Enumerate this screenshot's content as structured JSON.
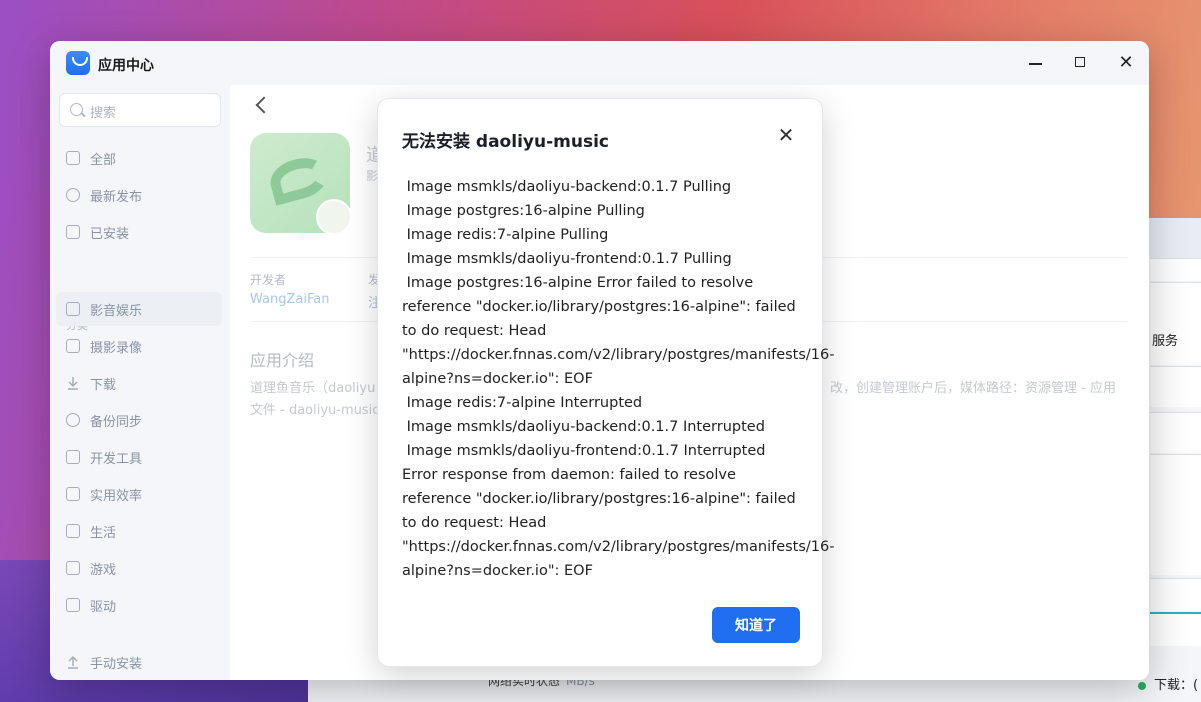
{
  "window": {
    "title": "应用中心"
  },
  "sidebar": {
    "search_placeholder": "搜索",
    "items": [
      {
        "label": "全部"
      },
      {
        "label": "最新发布"
      },
      {
        "label": "已安装"
      }
    ],
    "category_label": "分类",
    "categories": [
      {
        "label": "影音娱乐"
      },
      {
        "label": "摄影录像"
      },
      {
        "label": "下载"
      },
      {
        "label": "备份同步"
      },
      {
        "label": "开发工具"
      },
      {
        "label": "实用效率"
      },
      {
        "label": "生活"
      },
      {
        "label": "游戏"
      },
      {
        "label": "驱动"
      }
    ],
    "manual_install": "手动安装"
  },
  "app_detail": {
    "name_partial": "道",
    "sub_partial": "影",
    "developer_label": "开发者",
    "developer_value": "WangZaiFan",
    "meta2_label": "发",
    "meta2_value": "注",
    "intro_title": "应用介绍",
    "intro_left": "道理鱼音乐（daoliyu",
    "intro_left2": "文件 - daoliyu-music",
    "intro_right": "改，创建管理账户后，媒体路径：资源管理 - 应用"
  },
  "background_window": {
    "side_text": "服务",
    "footer_label": "网络实时状态",
    "footer_unit": "MB/s",
    "download_label": "下载：("
  },
  "dialog": {
    "title": "无法安装 daoliyu-music",
    "body": " Image msmkls/daoliyu-backend:0.1.7 Pulling\n Image postgres:16-alpine Pulling\n Image redis:7-alpine Pulling\n Image msmkls/daoliyu-frontend:0.1.7 Pulling\n Image postgres:16-alpine Error failed to resolve reference \"docker.io/library/postgres:16-alpine\": failed to do request: Head \"https://docker.fnnas.com/v2/library/postgres/manifests/16-alpine?ns=docker.io\": EOF\n Image redis:7-alpine Interrupted\n Image msmkls/daoliyu-backend:0.1.7 Interrupted\n Image msmkls/daoliyu-frontend:0.1.7 Interrupted\nError response from daemon: failed to resolve reference \"docker.io/library/postgres:16-alpine\": failed to do request: Head \"https://docker.fnnas.com/v2/library/postgres/manifests/16-alpine?ns=docker.io\": EOF",
    "ok_button": "知道了"
  }
}
